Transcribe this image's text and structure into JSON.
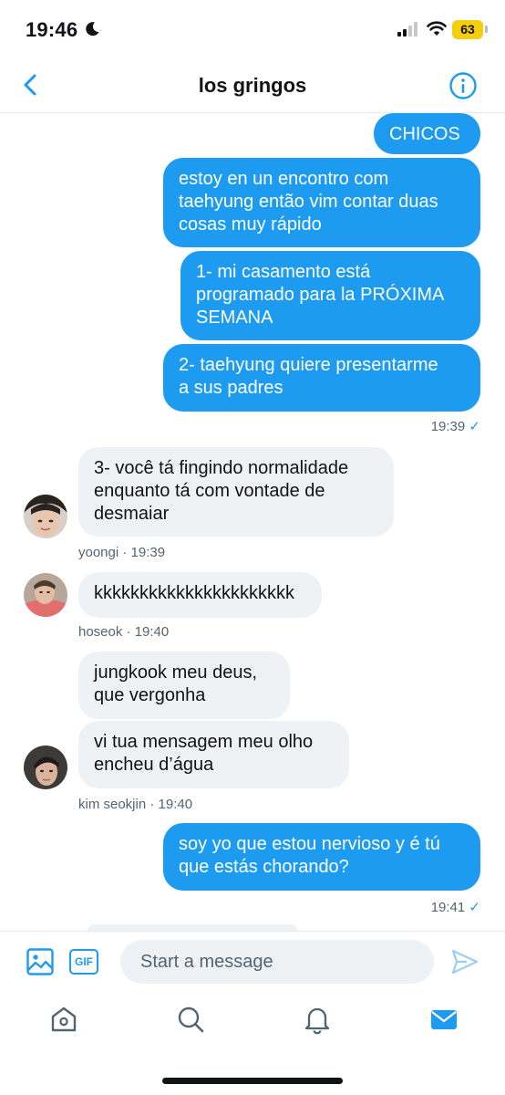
{
  "status_bar": {
    "time": "19:46",
    "battery": "63"
  },
  "header": {
    "title": "los gringos"
  },
  "messages": {
    "m1": "CHICOS",
    "m2_l1": "estoy en un encontro com",
    "m2_l2": "taehyung então vim contar duas",
    "m2_l3": "cosas muy rápido",
    "m3_l1": "1- mi casamento está",
    "m3_l2": "programado para la PRÓXIMA",
    "m3_l3": "SEMANA",
    "m4_l1": "2- taehyung quiere presentarme",
    "m4_l2": "a sus padres",
    "time1": "19:39",
    "m5_l1": "3- você tá fingindo normalidade",
    "m5_l2": "enquanto tá com vontade de",
    "m5_l3": "desmaiar",
    "meta5": "yoongi · 19:39",
    "m6": "kkkkkkkkkkkkkkkkkkkkkk",
    "meta6": "hoseok · 19:40",
    "m7_l1": "jungkook meu deus,",
    "m7_l2": "que vergonha",
    "m8_l1": "vi tua mensagem meu olho",
    "m8_l2": "encheu d’água",
    "meta8": "kim seokjin · 19:40",
    "m9_l1": "soy yo que estou nervioso y é tú",
    "m9_l2": "que estás chorando?",
    "time2": "19:41",
    "check": "✓"
  },
  "composer": {
    "gif_label": "GIF",
    "placeholder": "Start a message"
  },
  "colors": {
    "accent": "#1d9bf0",
    "incoming_bubble": "#eff2f5",
    "battery": "#f5cf0b"
  }
}
